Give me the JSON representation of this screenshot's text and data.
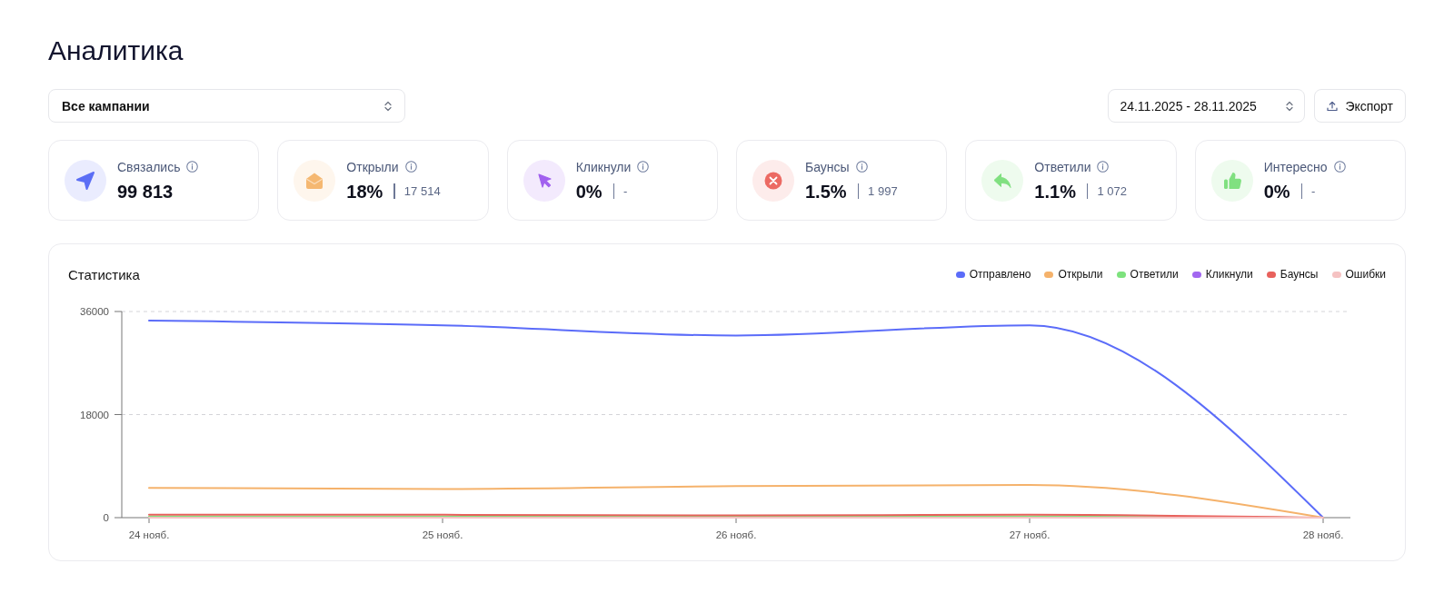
{
  "page": {
    "title": "Аналитика"
  },
  "filters": {
    "campaign_select": {
      "value": "Все кампании"
    },
    "date_range": {
      "value": "24.11.2025 - 28.11.2025"
    },
    "export_button": {
      "label": "Экспорт"
    }
  },
  "stat_cards": [
    {
      "kind": "sent",
      "label": "Связались",
      "value": "99 813",
      "color": "#5b6ef5"
    },
    {
      "kind": "opened",
      "label": "Открыли",
      "value": "18%",
      "count": "17 514",
      "color": "#f5b871"
    },
    {
      "kind": "clicked",
      "label": "Кликнули",
      "value": "0%",
      "count": "-",
      "color": "#a160ef"
    },
    {
      "kind": "bounced",
      "label": "Баунсы",
      "value": "1.5%",
      "count": "1 997",
      "color": "#ec6a63"
    },
    {
      "kind": "replied",
      "label": "Ответили",
      "value": "1.1%",
      "count": "1 072",
      "color": "#80e080"
    },
    {
      "kind": "interested",
      "label": "Интересно",
      "value": "0%",
      "count": "-",
      "color": "#80e080"
    }
  ],
  "chart": {
    "title": "Статистика",
    "chart_data": {
      "type": "line",
      "categories": [
        "24 нояб.",
        "25 нояб.",
        "26 нояб.",
        "27 нояб.",
        "28 нояб."
      ],
      "ylim": [
        0,
        36000
      ],
      "yticks": [
        0,
        18000,
        36000
      ],
      "series": [
        {
          "name": "Отправлено",
          "color": "#5b6cf9",
          "values": [
            34400,
            33600,
            31800,
            33600,
            0
          ]
        },
        {
          "name": "Открыли",
          "color": "#f5b26b",
          "values": [
            5200,
            5000,
            5500,
            5700,
            0
          ]
        },
        {
          "name": "Ответили",
          "color": "#7de27d",
          "values": [
            200,
            200,
            200,
            200,
            0
          ]
        },
        {
          "name": "Кликнули",
          "color": "#a267f0",
          "values": [
            null,
            null,
            null,
            null,
            null
          ]
        },
        {
          "name": "Баунсы",
          "color": "#e8615c",
          "values": [
            500,
            500,
            400,
            500,
            0
          ]
        },
        {
          "name": "Ошибки",
          "color": "#f5c2c2",
          "values": [
            0,
            0,
            0,
            0,
            0
          ]
        }
      ]
    }
  }
}
